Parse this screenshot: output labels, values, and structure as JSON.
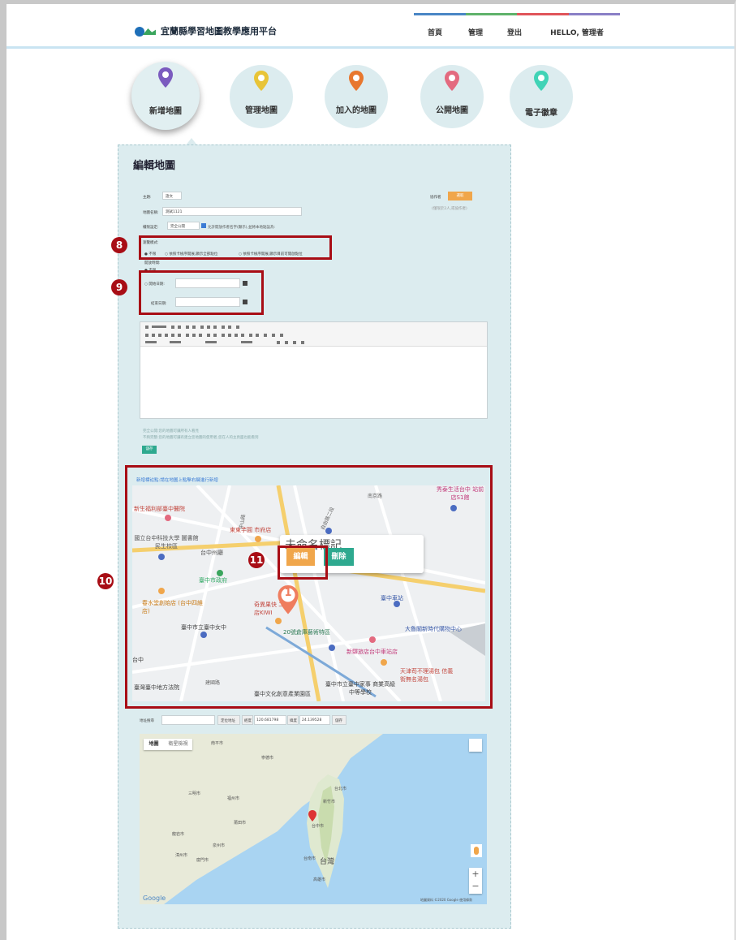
{
  "header": {
    "logo_text": "宜蘭縣學習地圖教學應用平台",
    "nav": [
      {
        "label": "首頁",
        "color": "#4a86c5"
      },
      {
        "label": "管理",
        "color": "#5fb26a"
      },
      {
        "label": "登出",
        "color": "#e0545a"
      },
      {
        "label": "HELLO, 管理者",
        "color": "#8a7fc6"
      }
    ]
  },
  "tabs": [
    {
      "label": "新增地圖",
      "pin_color": "#7b5bbf"
    },
    {
      "label": "管理地圖",
      "pin_color": "#e8c437"
    },
    {
      "label": "加入的地圖",
      "pin_color": "#e8772e"
    },
    {
      "label": "公開地圖",
      "pin_color": "#e36a7f"
    },
    {
      "label": "電子徽章",
      "pin_color": "#40d3b6"
    }
  ],
  "form": {
    "title": "編輯地圖",
    "subject_label": "主題:",
    "subject_value": "語文",
    "map_name_label": "地圖名稱:",
    "map_name_value": "測試1121",
    "permission_label": "權限設定:",
    "permission_value": "完全公開",
    "permission_note": "允許開放作者名字(顯示),並將本地點設為:",
    "author_label": "協作者",
    "author_btn": "選取",
    "author_note": "(僅限於2人,或協作者)",
    "browse_label": "瀏覽模式:",
    "browse_options": [
      "不限",
      "依照卡檢序開展,顯示全部點位",
      "依照卡檢序開展,顯示目前可開啟點位"
    ],
    "time_label": "開放時間:",
    "time_options": [
      "不限"
    ],
    "start_label": "開始日期:",
    "end_label": "結束日期:",
    "note1": "完全公開:您的地圖可讓所有人看見",
    "note2": "不夠完整:您的地圖可讓有建立您地圖的使用者,您在人的主頁面也能看到",
    "save_btn": "儲存"
  },
  "map1": {
    "hint": "新增標註點:請在地圖上點擊右鍵進行新增",
    "popup_title": "未命名標記",
    "edit_btn": "編輯",
    "delete_btn": "刪除",
    "marker_number": "1",
    "places": [
      "新生福利部臺中醫院",
      "國立台中科技大學 圖書館民生校區",
      "台中州廳",
      "東東芋圓 市府店",
      "臺中市政府",
      "春水堂創始店 (台中四維店)",
      "臺中市立臺中女中",
      "奇異果快 二店KIWI",
      "20號倉庫藝術特區",
      "臺中車站",
      "大魯閣新時代購物中心",
      "新驛旅店台中車站店",
      "秀泰生活台中 站前店S1館",
      "天津苟不理湯包 信義街無名湯包",
      "臺灣臺中地方法院",
      "臺中文化創意產業園區",
      "臺中市立臺中家事 商業高級中等學校",
      "中山路",
      "自由路二段",
      "建國路",
      "南京路",
      "台中"
    ]
  },
  "coords": {
    "address_label": "地址搜尋",
    "locate_btn": "定位地址",
    "lng_label": "經度",
    "lng_value": "120.681798",
    "lat_label": "緯度",
    "lat_value": "24.139528",
    "confirm_btn": "儲存"
  },
  "map2": {
    "tab_map": "地圖",
    "tab_satellite": "衛星檢視",
    "google": "Google",
    "copyright": "地圖資料 ©2020 Google 使用條款",
    "places": [
      "台灣",
      "台中市",
      "新竹市",
      "台北市",
      "高雄市",
      "台南市",
      "福州市",
      "廈門市",
      "泉州市",
      "漳州市",
      "南平市",
      "寧德市",
      "龍岩市",
      "莆田市",
      "三明市"
    ]
  },
  "annotations": [
    "8",
    "9",
    "10",
    "11"
  ]
}
